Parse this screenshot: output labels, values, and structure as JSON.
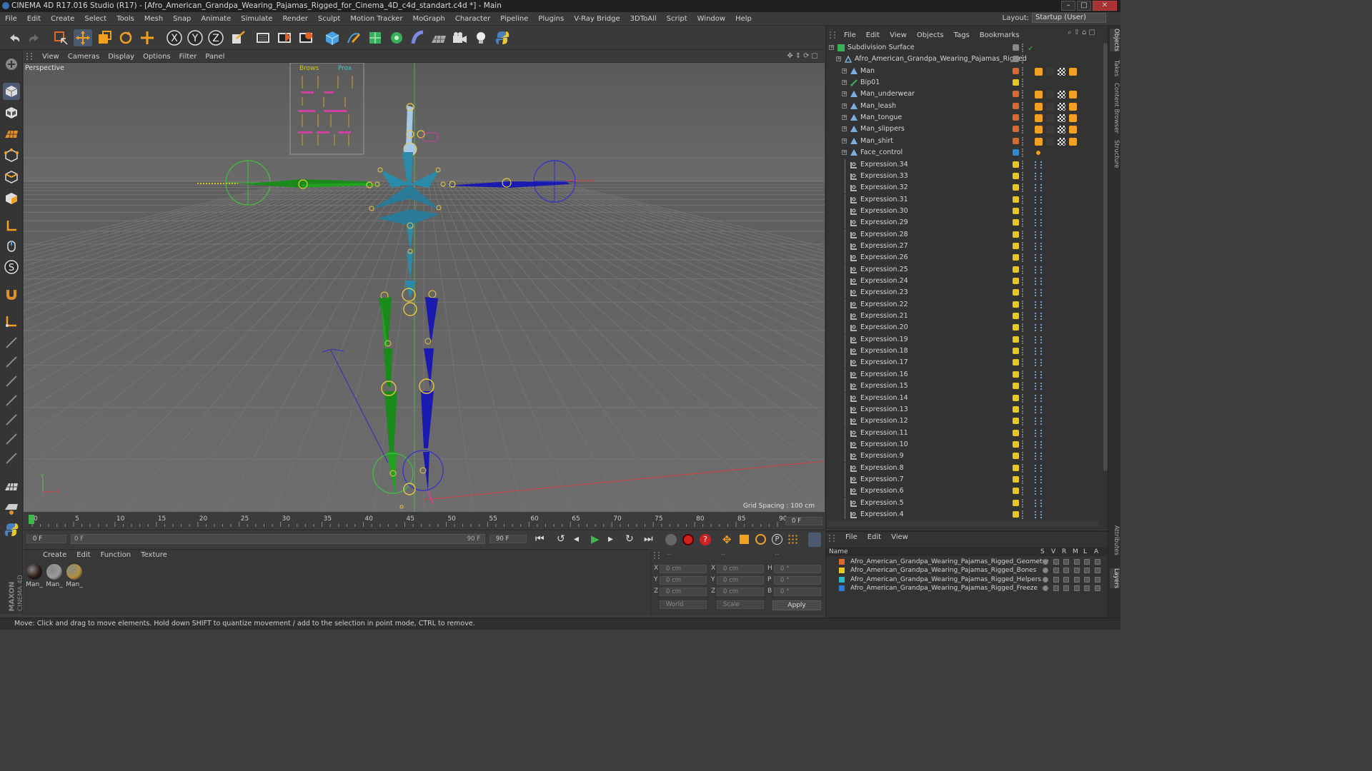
{
  "titlebar": {
    "title": "CINEMA 4D R17.016 Studio (R17) - [Afro_American_Grandpa_Wearing_Pajamas_Rigged_for_Cinema_4D_c4d_standart.c4d *] - Main"
  },
  "menubar": {
    "items": [
      "File",
      "Edit",
      "Create",
      "Select",
      "Tools",
      "Mesh",
      "Snap",
      "Animate",
      "Simulate",
      "Render",
      "Sculpt",
      "Motion Tracker",
      "MoGraph",
      "Character",
      "Pipeline",
      "Plugins",
      "V-Ray Bridge",
      "3DToAll",
      "Script",
      "Window",
      "Help"
    ]
  },
  "layout": {
    "label": "Layout:",
    "value": "Startup (User)"
  },
  "viewport": {
    "menu": [
      "View",
      "Cameras",
      "Display",
      "Options",
      "Filter",
      "Panel"
    ],
    "camera_label": "Perspective",
    "grid_spacing": "Grid Spacing : 100 cm",
    "axis_y": "Y",
    "axis_x": "X",
    "face_control_labels": [
      "Brows",
      "Prox"
    ]
  },
  "timeline": {
    "ticks": [
      "0",
      "5",
      "10",
      "15",
      "20",
      "25",
      "30",
      "35",
      "40",
      "45",
      "50",
      "55",
      "60",
      "65",
      "70",
      "75",
      "80",
      "85",
      "90"
    ],
    "current_frame": "0 F"
  },
  "playbar": {
    "start": "0 F",
    "range_start": "0 F",
    "range_end": "90 F",
    "end": "90 F"
  },
  "material_panel": {
    "menu": [
      "Create",
      "Edit",
      "Function",
      "Texture"
    ],
    "materials": [
      {
        "label": "Man_",
        "color": "#2a1a14"
      },
      {
        "label": "Man_",
        "color": "#9a9a9a"
      },
      {
        "label": "Man_",
        "color": "#b09040"
      }
    ]
  },
  "coords": {
    "header": [
      "--",
      "--",
      "--"
    ],
    "rows": [
      {
        "a": "X",
        "av": "0 cm",
        "b": "X",
        "bv": "0 cm",
        "c": "H",
        "cv": "0 °"
      },
      {
        "a": "Y",
        "av": "0 cm",
        "b": "Y",
        "bv": "0 cm",
        "c": "P",
        "cv": "0 °"
      },
      {
        "a": "Z",
        "av": "0 cm",
        "b": "Z",
        "bv": "0 cm",
        "c": "B",
        "cv": "0 °"
      }
    ],
    "world": "World",
    "scale": "Scale",
    "apply": "Apply"
  },
  "status": {
    "text": "Move: Click and drag to move elements. Hold down SHIFT to quantize movement / add to the selection in point mode, CTRL to remove."
  },
  "objects": {
    "menu": [
      "File",
      "Edit",
      "View",
      "Objects",
      "Tags",
      "Bookmarks"
    ],
    "items": [
      {
        "name": "Subdivision Surface",
        "color": "#8a8a8a",
        "kind": "sds"
      },
      {
        "name": "Afro_American_Grandpa_Wearing_Pajamas_Rigged",
        "color": "#8a8a8a",
        "kind": "null"
      },
      {
        "name": "Man",
        "color": "#d76a2a",
        "kind": "obj"
      },
      {
        "name": "Bip01",
        "color": "#e8c820",
        "kind": "bone"
      },
      {
        "name": "Man_underwear",
        "color": "#d76a2a",
        "kind": "obj"
      },
      {
        "name": "Man_leash",
        "color": "#d76a2a",
        "kind": "obj"
      },
      {
        "name": "Man_tongue",
        "color": "#d76a2a",
        "kind": "obj"
      },
      {
        "name": "Man_slippers",
        "color": "#d76a2a",
        "kind": "obj"
      },
      {
        "name": "Man_shirt",
        "color": "#d76a2a",
        "kind": "obj"
      },
      {
        "name": "Face_control",
        "color": "#2a8ad7",
        "kind": "obj"
      },
      {
        "name": "Expression.34",
        "color": "#e8c820",
        "kind": "expr"
      },
      {
        "name": "Expression.33",
        "color": "#e8c820",
        "kind": "expr"
      },
      {
        "name": "Expression.32",
        "color": "#e8c820",
        "kind": "expr"
      },
      {
        "name": "Expression.31",
        "color": "#e8c820",
        "kind": "expr"
      },
      {
        "name": "Expression.30",
        "color": "#e8c820",
        "kind": "expr"
      },
      {
        "name": "Expression.29",
        "color": "#e8c820",
        "kind": "expr"
      },
      {
        "name": "Expression.28",
        "color": "#e8c820",
        "kind": "expr"
      },
      {
        "name": "Expression.27",
        "color": "#e8c820",
        "kind": "expr"
      },
      {
        "name": "Expression.26",
        "color": "#e8c820",
        "kind": "expr"
      },
      {
        "name": "Expression.25",
        "color": "#e8c820",
        "kind": "expr"
      },
      {
        "name": "Expression.24",
        "color": "#e8c820",
        "kind": "expr"
      },
      {
        "name": "Expression.23",
        "color": "#e8c820",
        "kind": "expr"
      },
      {
        "name": "Expression.22",
        "color": "#e8c820",
        "kind": "expr"
      },
      {
        "name": "Expression.21",
        "color": "#e8c820",
        "kind": "expr"
      },
      {
        "name": "Expression.20",
        "color": "#e8c820",
        "kind": "expr"
      },
      {
        "name": "Expression.19",
        "color": "#e8c820",
        "kind": "expr"
      },
      {
        "name": "Expression.18",
        "color": "#e8c820",
        "kind": "expr"
      },
      {
        "name": "Expression.17",
        "color": "#e8c820",
        "kind": "expr"
      },
      {
        "name": "Expression.16",
        "color": "#e8c820",
        "kind": "expr"
      },
      {
        "name": "Expression.15",
        "color": "#e8c820",
        "kind": "expr"
      },
      {
        "name": "Expression.14",
        "color": "#e8c820",
        "kind": "expr"
      },
      {
        "name": "Expression.13",
        "color": "#e8c820",
        "kind": "expr"
      },
      {
        "name": "Expression.12",
        "color": "#e8c820",
        "kind": "expr"
      },
      {
        "name": "Expression.11",
        "color": "#e8c820",
        "kind": "expr"
      },
      {
        "name": "Expression.10",
        "color": "#e8c820",
        "kind": "expr"
      },
      {
        "name": "Expression.9",
        "color": "#e8c820",
        "kind": "expr"
      },
      {
        "name": "Expression.8",
        "color": "#e8c820",
        "kind": "expr"
      },
      {
        "name": "Expression.7",
        "color": "#e8c820",
        "kind": "expr"
      },
      {
        "name": "Expression.6",
        "color": "#e8c820",
        "kind": "expr"
      },
      {
        "name": "Expression.5",
        "color": "#e8c820",
        "kind": "expr"
      },
      {
        "name": "Expression.4",
        "color": "#e8c820",
        "kind": "expr"
      }
    ]
  },
  "layers": {
    "menu": [
      "File",
      "Edit",
      "View"
    ],
    "columns": [
      "Name",
      "S",
      "V",
      "R",
      "M",
      "L",
      "A"
    ],
    "items": [
      {
        "name": "Afro_American_Grandpa_Wearing_Pajamas_Rigged_Geometry",
        "color": "#d76a2a"
      },
      {
        "name": "Afro_American_Grandpa_Wearing_Pajamas_Rigged_Bones",
        "color": "#e8c820"
      },
      {
        "name": "Afro_American_Grandpa_Wearing_Pajamas_Rigged_Helpers",
        "color": "#2ab7c8"
      },
      {
        "name": "Afro_American_Grandpa_Wearing_Pajamas_Rigged_Freeze",
        "color": "#2a7ad7"
      }
    ]
  },
  "right_tabs": [
    "Objects",
    "Takes",
    "Content Browser",
    "Structure",
    "Attributes",
    "Layers"
  ],
  "brand": {
    "line1": "MAXON",
    "line2": "CINEMA 4D"
  }
}
